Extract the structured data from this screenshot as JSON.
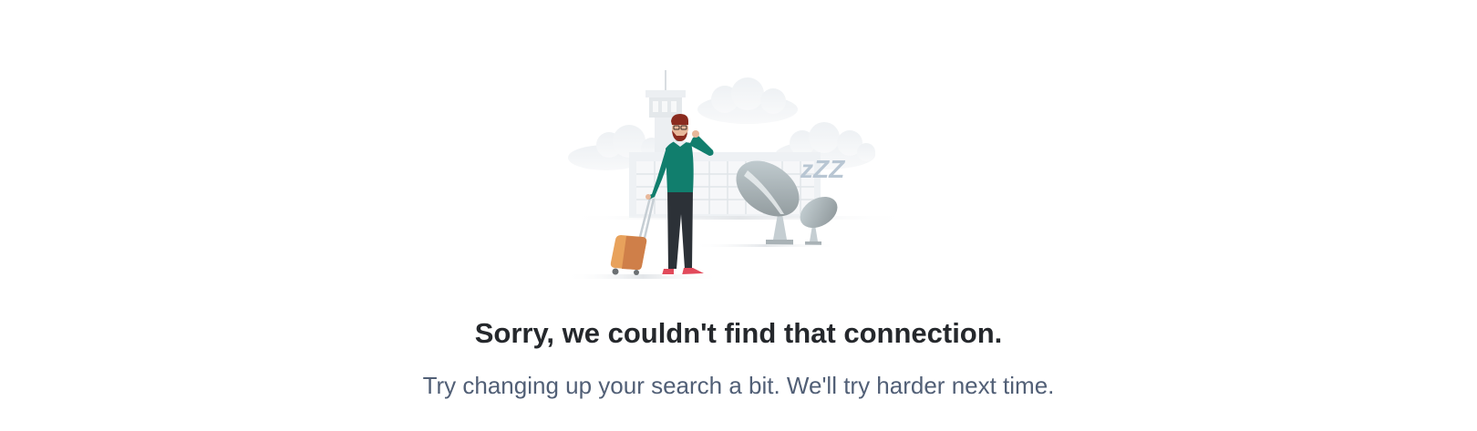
{
  "empty_state": {
    "illustration": "traveler-with-suitcase-at-airport-icon",
    "title": "Sorry, we couldn't find that connection.",
    "message": "Try changing up your search a bit. We'll try harder next time.",
    "sleep_text": "zZZ"
  },
  "colors": {
    "title": "#25282c",
    "message": "#515f76",
    "sweater": "#117e6d",
    "suitcase": "#e8a25c"
  }
}
